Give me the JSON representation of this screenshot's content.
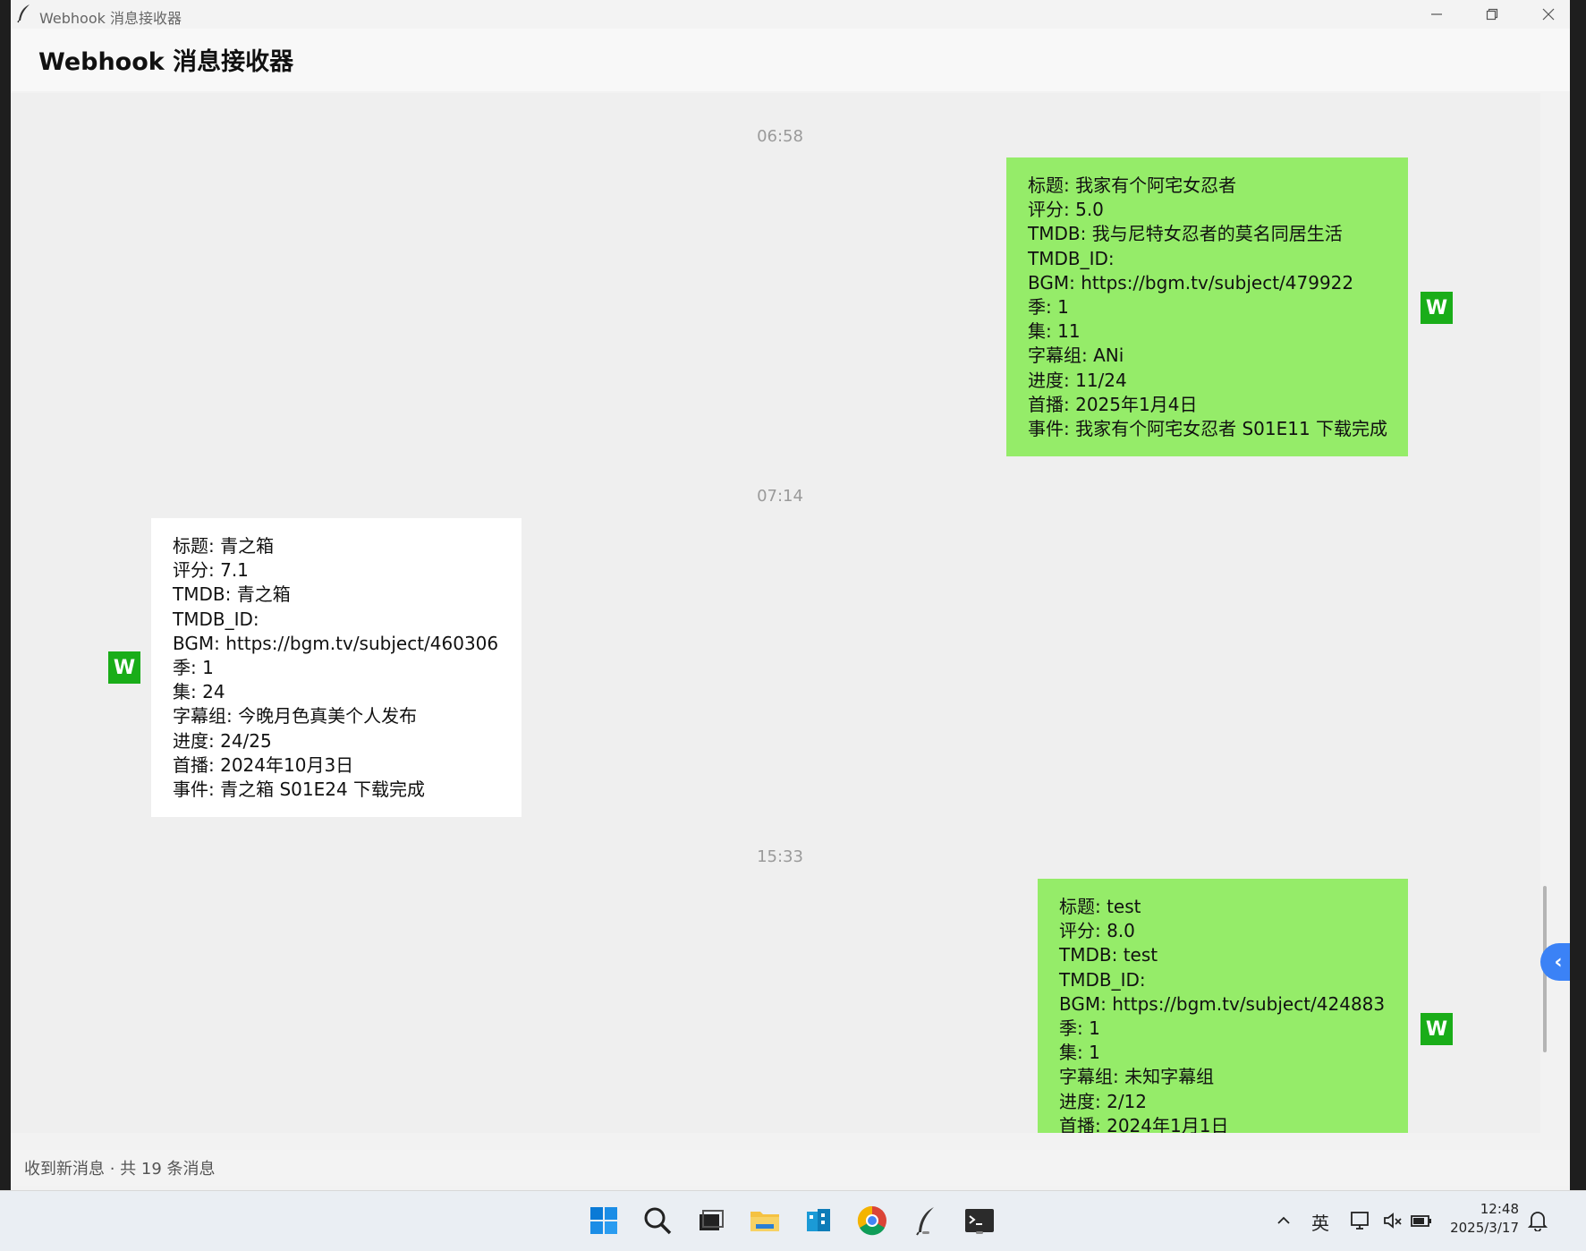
{
  "window": {
    "title": "Webhook 消息接收器"
  },
  "header": {
    "title": "Webhook 消息接收器"
  },
  "messages": [
    {
      "time": "06:58",
      "side": "right",
      "avatar": "W",
      "lines": [
        "标题: 我家有个阿宅女忍者",
        "评分: 5.0",
        "TMDB: 我与尼特女忍者的莫名同居生活",
        "TMDB_ID:",
        "BGM: https://bgm.tv/subject/479922",
        "季: 1",
        "集: 11",
        "字幕组: ANi",
        "进度: 11/24",
        "首播: 2025年1月4日",
        "事件: 我家有个阿宅女忍者 S01E11 下载完成"
      ]
    },
    {
      "time": "07:14",
      "side": "left",
      "avatar": "W",
      "lines": [
        "标题: 青之箱",
        "评分: 7.1",
        "TMDB: 青之箱",
        "TMDB_ID:",
        "BGM: https://bgm.tv/subject/460306",
        "季: 1",
        "集: 24",
        "字幕组: 今晚月色真美个人发布",
        "进度: 24/25",
        "首播: 2024年10月3日",
        "事件: 青之箱 S01E24 下载完成"
      ]
    },
    {
      "time": "15:33",
      "side": "right",
      "avatar": "W",
      "lines": [
        "标题: test",
        "评分: 8.0",
        "TMDB: test",
        "TMDB_ID:",
        "BGM: https://bgm.tv/subject/424883",
        "季: 1",
        "集: 1",
        "字幕组: 未知字幕组",
        "进度: 2/12",
        "首播: 2024年1月1日"
      ]
    }
  ],
  "status": {
    "text": "收到新消息 · 共 19 条消息"
  },
  "taskbar": {
    "ime": "英",
    "time": "12:48",
    "date": "2025/3/17"
  },
  "colors": {
    "sent_bubble": "#95ec69",
    "received_bubble": "#ffffff",
    "avatar": "#1aad19",
    "side_tab": "#3b82f6"
  }
}
